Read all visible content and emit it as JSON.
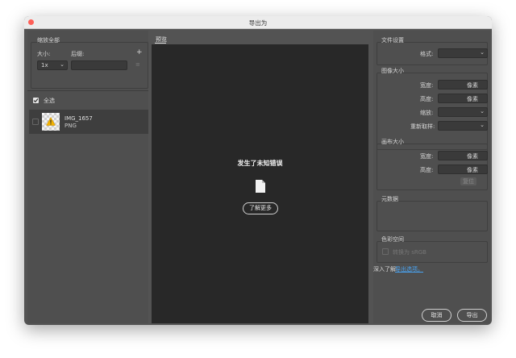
{
  "window": {
    "title": "导出为"
  },
  "left": {
    "scale_all": "缩放全部",
    "size_label": "大小:",
    "suffix_label": "后缀:",
    "add_symbol": "+",
    "scale_value": "1x",
    "suffix_value": "",
    "select_all": "全选",
    "assets": [
      {
        "name": "IMG_1657",
        "format": "PNG"
      }
    ]
  },
  "preview": {
    "tab": "预览",
    "error_title": "发生了未知错误",
    "learn_more": "了解更多"
  },
  "right": {
    "file_settings": {
      "title": "文件设置",
      "format_label": "格式:",
      "format_value": ""
    },
    "image_size": {
      "title": "图像大小",
      "width_label": "宽度:",
      "height_label": "高度:",
      "scale_label": "缩放:",
      "resample_label": "重新取样:",
      "unit": "像素"
    },
    "canvas_size": {
      "title": "画布大小",
      "width_label": "宽度:",
      "height_label": "高度:",
      "unit": "像素",
      "reset": "复位"
    },
    "metadata": {
      "title": "元数据"
    },
    "color_space": {
      "title": "色彩空间",
      "convert_label": "转换为 sRGB"
    },
    "learn_more_prefix": "深入了解:",
    "learn_more_link": "导出选项。"
  },
  "footer": {
    "cancel": "取消",
    "export": "导出"
  },
  "colors": {
    "accent_link": "#4aa3f0",
    "close": "#fe5f57"
  }
}
